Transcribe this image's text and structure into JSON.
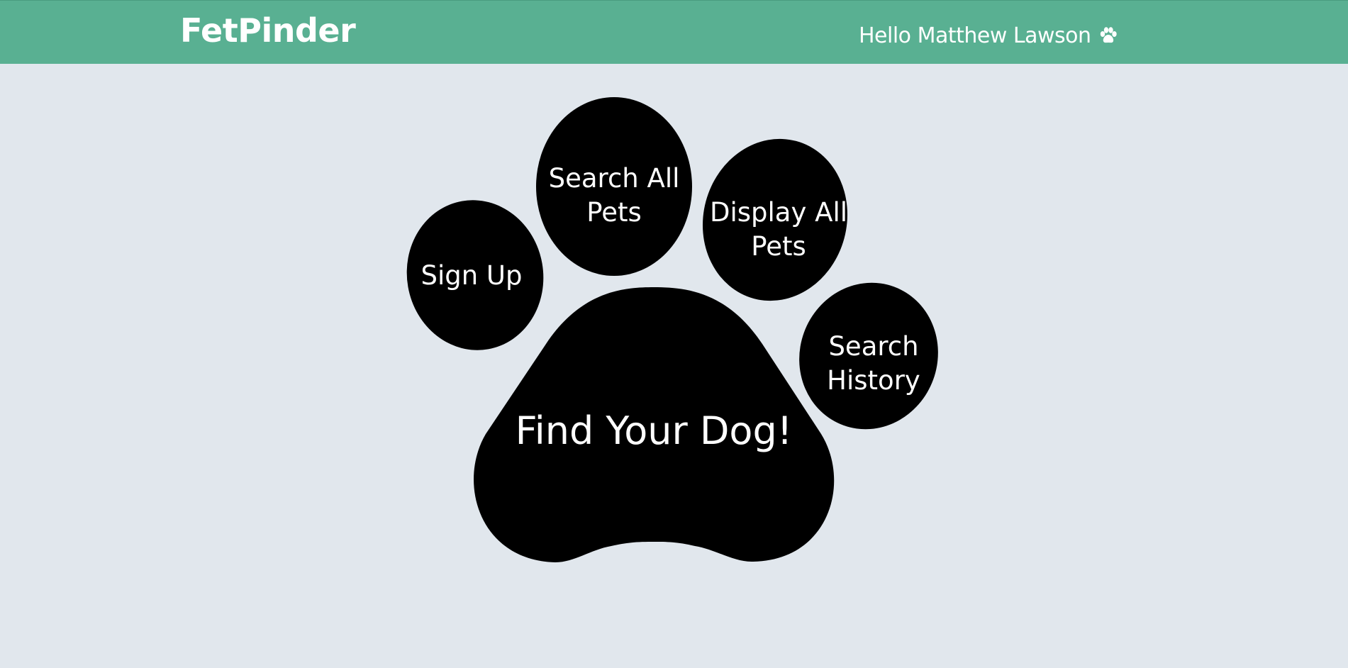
{
  "header": {
    "brand": "FetPinder",
    "greeting": "Hello Matthew Lawson",
    "greeting_icon": "paw-icon"
  },
  "paw": {
    "sign_up": {
      "lines": [
        "Sign Up"
      ]
    },
    "search_all_pets": {
      "lines": [
        "Search All",
        "Pets"
      ]
    },
    "display_all_pets": {
      "lines": [
        "Display All",
        "Pets"
      ]
    },
    "search_history": {
      "lines": [
        "Search",
        "History"
      ]
    },
    "find_your_dog": {
      "lines": [
        "Find Your Dog!"
      ]
    }
  },
  "colors": {
    "header_bg": "#59b092",
    "page_bg": "#e1e7ed",
    "pad_fill": "#000000",
    "text": "#ffffff"
  }
}
